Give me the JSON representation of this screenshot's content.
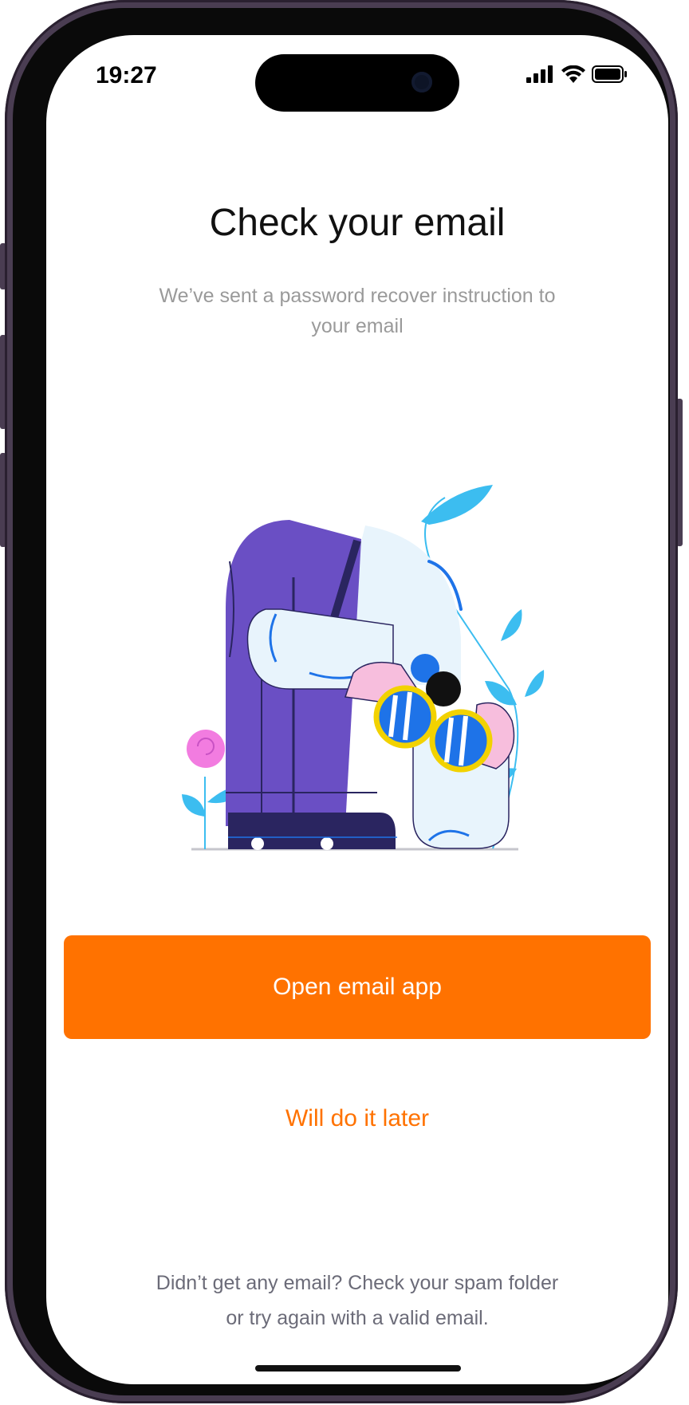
{
  "status_bar": {
    "time": "19:27",
    "signal_icon": "cellular-signal-icon",
    "wifi_icon": "wifi-icon",
    "battery_icon": "battery-icon"
  },
  "main": {
    "title": "Check your email",
    "subtitle": "We’ve sent a password recover instruction to your email",
    "illustration_icon": "person-with-binoculars-illustration"
  },
  "actions": {
    "primary_label": "Open email app",
    "secondary_label": "Will do it later"
  },
  "footer": {
    "note": "Didn’t get any email? Check your spam folder or try again with a valid email."
  },
  "colors": {
    "accent": "#ff7200",
    "purple": "#6a4fc4",
    "navy": "#2a2560",
    "blue": "#1e73e8",
    "light_blue": "#3cbdf0",
    "pink": "#f7bedd",
    "yellow": "#f2d200"
  }
}
